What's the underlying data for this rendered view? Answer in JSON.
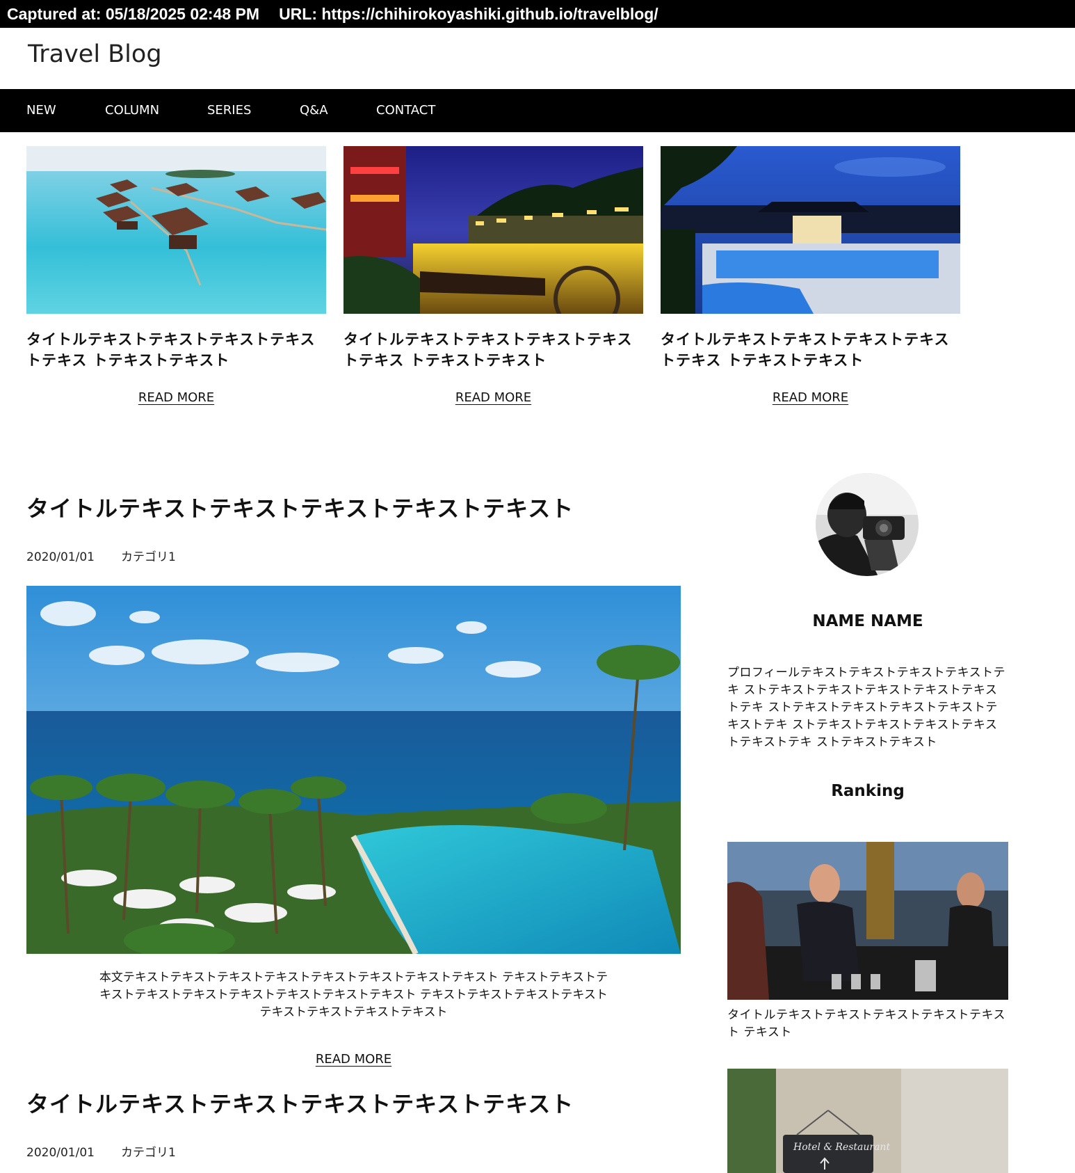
{
  "capture": {
    "captured_label": "Captured at: 05/18/2025 02:48 PM",
    "url_label": "URL: https://chihirokoyashiki.github.io/travelblog/"
  },
  "site": {
    "title": "Travel Blog"
  },
  "nav": {
    "items": [
      {
        "label": "NEW"
      },
      {
        "label": "COLUMN"
      },
      {
        "label": "SERIES"
      },
      {
        "label": "Q&A"
      },
      {
        "label": "CONTACT"
      }
    ]
  },
  "featured": [
    {
      "title": "タイトルテキストテキストテキストテキストテキス トテキストテキスト",
      "read_more": "READ MORE"
    },
    {
      "title": "タイトルテキストテキストテキストテキストテキス トテキストテキスト",
      "read_more": "READ MORE"
    },
    {
      "title": "タイトルテキストテキストテキストテキストテキス トテキストテキスト",
      "read_more": "READ MORE"
    }
  ],
  "posts": [
    {
      "title": "タイトルテキストテキストテキストテキストテキスト",
      "date": "2020/01/01",
      "category": "カテゴリ1",
      "body": "本文テキストテキストテキストテキストテキストテキストテキストテキスト テキストテキストテキストテキストテキストテキストテキストテキストテキスト テキストテキストテキストテキストテキストテキストテキストテキスト",
      "read_more": "READ MORE"
    },
    {
      "title": "タイトルテキストテキストテキストテキストテキスト",
      "date": "2020/01/01",
      "category": "カテゴリ1"
    }
  ],
  "profile": {
    "name": "NAME NAME",
    "text": "プロフィールテキストテキストテキストテキストテキ ストテキストテキストテキストテキストテキストテキ ストテキストテキストテキストテキストテキストテキ ストテキストテキストテキストテキストテキストテキ ストテキストテキスト"
  },
  "ranking": {
    "title": "Ranking",
    "items": [
      {
        "title": "タイトルテキストテキストテキストテキストテキス ト テキスト"
      }
    ]
  },
  "colors": {
    "nav_bg": "#000000",
    "page_bg": "#ffffff",
    "text": "#111111"
  }
}
